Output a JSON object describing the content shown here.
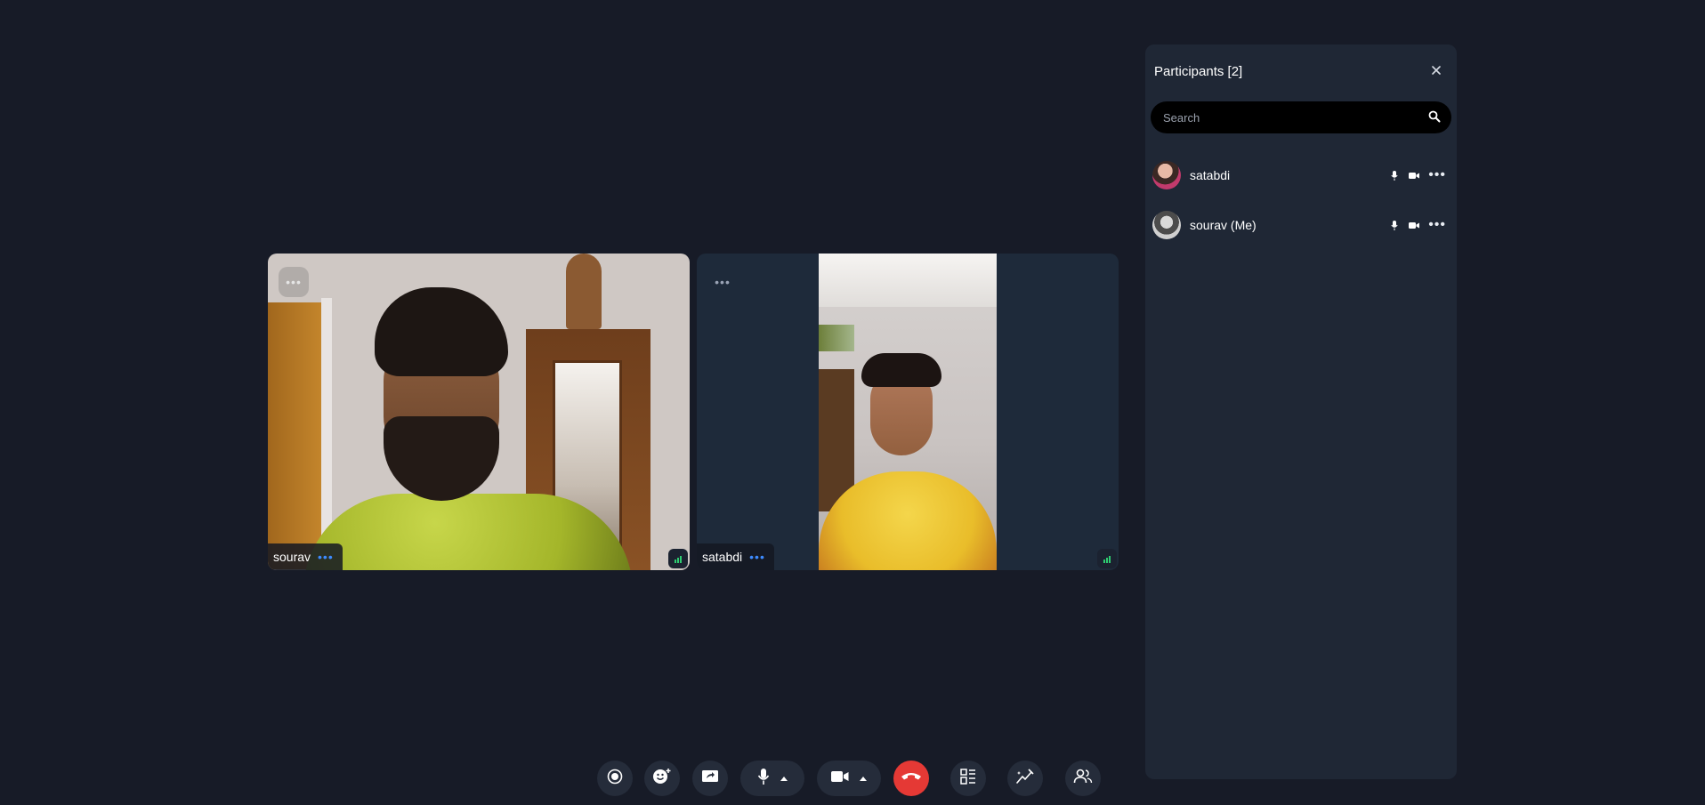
{
  "tiles": [
    {
      "name": "sourav"
    },
    {
      "name": "satabdi"
    }
  ],
  "participants_panel": {
    "title": "Participants [2]",
    "search_placeholder": "Search",
    "participants": [
      {
        "name": "satabdi"
      },
      {
        "name": "sourav (Me)"
      }
    ]
  },
  "controls": {
    "items": [
      "record",
      "reactions",
      "share-screen",
      "microphone",
      "camera",
      "end-call",
      "layout",
      "whiteboard",
      "participants"
    ]
  },
  "colors": {
    "background": "#171b27",
    "panel": "#1f2735",
    "end_call": "#e53935",
    "accent": "#3d8bff",
    "signal": "#2ecc71"
  }
}
